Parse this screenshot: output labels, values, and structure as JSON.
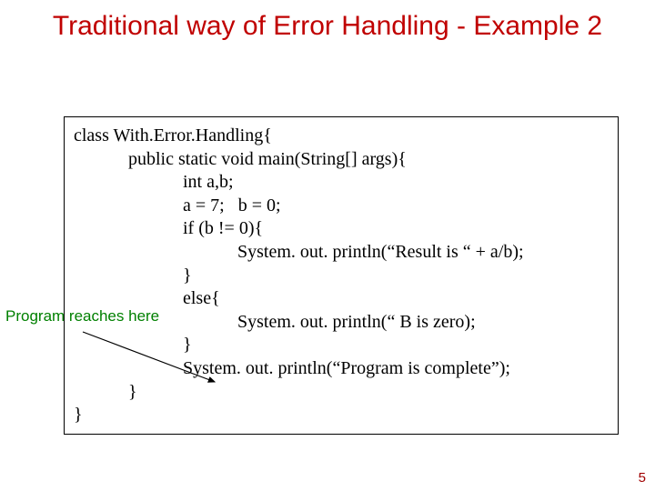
{
  "title": "Traditional way of Error Handling - Example 2",
  "annotation": "Program reaches here",
  "page_number": "5",
  "code": {
    "l0": "class With.Error.Handling{",
    "l1": "            public static void main(String[] args){",
    "l2": "                        int a,b;",
    "l3": "                        a = 7;   b = 0;",
    "l4": "                        if (b != 0){",
    "l5": "                                    System. out. println(“Result is “ + a/b);",
    "l6": "                        }",
    "l7": "                        else{",
    "l8": "                                    System. out. println(“ B is zero);",
    "l9": "                        }",
    "l10": "                        System. out. println(“Program is complete”);",
    "l11": "            }",
    "l12": "}"
  }
}
